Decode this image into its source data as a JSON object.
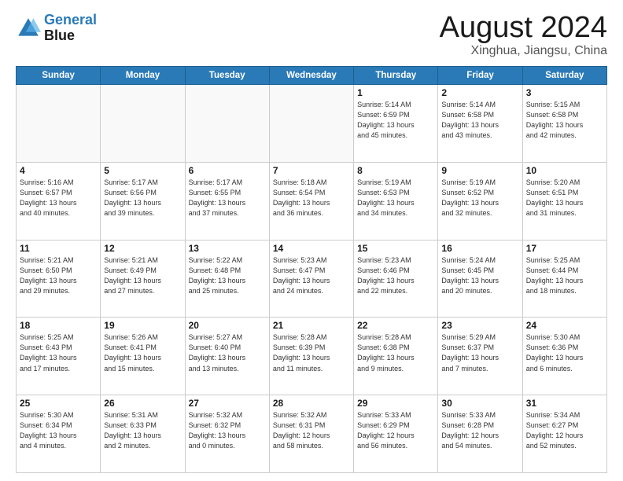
{
  "header": {
    "logo_line1": "General",
    "logo_line2": "Blue",
    "month": "August 2024",
    "location": "Xinghua, Jiangsu, China"
  },
  "weekdays": [
    "Sunday",
    "Monday",
    "Tuesday",
    "Wednesday",
    "Thursday",
    "Friday",
    "Saturday"
  ],
  "weeks": [
    [
      {
        "day": "",
        "info": ""
      },
      {
        "day": "",
        "info": ""
      },
      {
        "day": "",
        "info": ""
      },
      {
        "day": "",
        "info": ""
      },
      {
        "day": "1",
        "info": "Sunrise: 5:14 AM\nSunset: 6:59 PM\nDaylight: 13 hours\nand 45 minutes."
      },
      {
        "day": "2",
        "info": "Sunrise: 5:14 AM\nSunset: 6:58 PM\nDaylight: 13 hours\nand 43 minutes."
      },
      {
        "day": "3",
        "info": "Sunrise: 5:15 AM\nSunset: 6:58 PM\nDaylight: 13 hours\nand 42 minutes."
      }
    ],
    [
      {
        "day": "4",
        "info": "Sunrise: 5:16 AM\nSunset: 6:57 PM\nDaylight: 13 hours\nand 40 minutes."
      },
      {
        "day": "5",
        "info": "Sunrise: 5:17 AM\nSunset: 6:56 PM\nDaylight: 13 hours\nand 39 minutes."
      },
      {
        "day": "6",
        "info": "Sunrise: 5:17 AM\nSunset: 6:55 PM\nDaylight: 13 hours\nand 37 minutes."
      },
      {
        "day": "7",
        "info": "Sunrise: 5:18 AM\nSunset: 6:54 PM\nDaylight: 13 hours\nand 36 minutes."
      },
      {
        "day": "8",
        "info": "Sunrise: 5:19 AM\nSunset: 6:53 PM\nDaylight: 13 hours\nand 34 minutes."
      },
      {
        "day": "9",
        "info": "Sunrise: 5:19 AM\nSunset: 6:52 PM\nDaylight: 13 hours\nand 32 minutes."
      },
      {
        "day": "10",
        "info": "Sunrise: 5:20 AM\nSunset: 6:51 PM\nDaylight: 13 hours\nand 31 minutes."
      }
    ],
    [
      {
        "day": "11",
        "info": "Sunrise: 5:21 AM\nSunset: 6:50 PM\nDaylight: 13 hours\nand 29 minutes."
      },
      {
        "day": "12",
        "info": "Sunrise: 5:21 AM\nSunset: 6:49 PM\nDaylight: 13 hours\nand 27 minutes."
      },
      {
        "day": "13",
        "info": "Sunrise: 5:22 AM\nSunset: 6:48 PM\nDaylight: 13 hours\nand 25 minutes."
      },
      {
        "day": "14",
        "info": "Sunrise: 5:23 AM\nSunset: 6:47 PM\nDaylight: 13 hours\nand 24 minutes."
      },
      {
        "day": "15",
        "info": "Sunrise: 5:23 AM\nSunset: 6:46 PM\nDaylight: 13 hours\nand 22 minutes."
      },
      {
        "day": "16",
        "info": "Sunrise: 5:24 AM\nSunset: 6:45 PM\nDaylight: 13 hours\nand 20 minutes."
      },
      {
        "day": "17",
        "info": "Sunrise: 5:25 AM\nSunset: 6:44 PM\nDaylight: 13 hours\nand 18 minutes."
      }
    ],
    [
      {
        "day": "18",
        "info": "Sunrise: 5:25 AM\nSunset: 6:43 PM\nDaylight: 13 hours\nand 17 minutes."
      },
      {
        "day": "19",
        "info": "Sunrise: 5:26 AM\nSunset: 6:41 PM\nDaylight: 13 hours\nand 15 minutes."
      },
      {
        "day": "20",
        "info": "Sunrise: 5:27 AM\nSunset: 6:40 PM\nDaylight: 13 hours\nand 13 minutes."
      },
      {
        "day": "21",
        "info": "Sunrise: 5:28 AM\nSunset: 6:39 PM\nDaylight: 13 hours\nand 11 minutes."
      },
      {
        "day": "22",
        "info": "Sunrise: 5:28 AM\nSunset: 6:38 PM\nDaylight: 13 hours\nand 9 minutes."
      },
      {
        "day": "23",
        "info": "Sunrise: 5:29 AM\nSunset: 6:37 PM\nDaylight: 13 hours\nand 7 minutes."
      },
      {
        "day": "24",
        "info": "Sunrise: 5:30 AM\nSunset: 6:36 PM\nDaylight: 13 hours\nand 6 minutes."
      }
    ],
    [
      {
        "day": "25",
        "info": "Sunrise: 5:30 AM\nSunset: 6:34 PM\nDaylight: 13 hours\nand 4 minutes."
      },
      {
        "day": "26",
        "info": "Sunrise: 5:31 AM\nSunset: 6:33 PM\nDaylight: 13 hours\nand 2 minutes."
      },
      {
        "day": "27",
        "info": "Sunrise: 5:32 AM\nSunset: 6:32 PM\nDaylight: 13 hours\nand 0 minutes."
      },
      {
        "day": "28",
        "info": "Sunrise: 5:32 AM\nSunset: 6:31 PM\nDaylight: 12 hours\nand 58 minutes."
      },
      {
        "day": "29",
        "info": "Sunrise: 5:33 AM\nSunset: 6:29 PM\nDaylight: 12 hours\nand 56 minutes."
      },
      {
        "day": "30",
        "info": "Sunrise: 5:33 AM\nSunset: 6:28 PM\nDaylight: 12 hours\nand 54 minutes."
      },
      {
        "day": "31",
        "info": "Sunrise: 5:34 AM\nSunset: 6:27 PM\nDaylight: 12 hours\nand 52 minutes."
      }
    ]
  ]
}
